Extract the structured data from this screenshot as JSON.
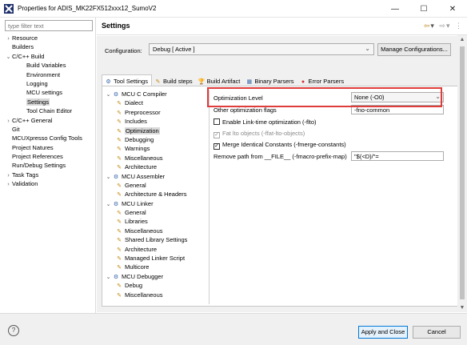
{
  "window": {
    "title": "Properties for ADIS_MK22FX512xxx12_SumoV2",
    "app_icon": "x-icon",
    "minimize_glyph": "—",
    "maximize_glyph": "☐",
    "close_glyph": "✕"
  },
  "sidebar": {
    "filter_placeholder": "type filter text",
    "items": [
      {
        "label": "Resource",
        "twisty": "›",
        "indent": 0
      },
      {
        "label": "Builders",
        "twisty": "",
        "indent": 0
      },
      {
        "label": "C/C++ Build",
        "twisty": "⌄",
        "indent": 0
      },
      {
        "label": "Build Variables",
        "twisty": "",
        "indent": 1
      },
      {
        "label": "Environment",
        "twisty": "",
        "indent": 1
      },
      {
        "label": "Logging",
        "twisty": "",
        "indent": 1
      },
      {
        "label": "MCU settings",
        "twisty": "",
        "indent": 1
      },
      {
        "label": "Settings",
        "twisty": "",
        "indent": 1,
        "selected": true
      },
      {
        "label": "Tool Chain Editor",
        "twisty": "",
        "indent": 1
      },
      {
        "label": "C/C++ General",
        "twisty": "›",
        "indent": 0
      },
      {
        "label": "Git",
        "twisty": "",
        "indent": 0
      },
      {
        "label": "MCUXpresso Config Tools",
        "twisty": "",
        "indent": 0
      },
      {
        "label": "Project Natures",
        "twisty": "",
        "indent": 0
      },
      {
        "label": "Project References",
        "twisty": "",
        "indent": 0
      },
      {
        "label": "Run/Debug Settings",
        "twisty": "",
        "indent": 0
      },
      {
        "label": "Task Tags",
        "twisty": "›",
        "indent": 0
      },
      {
        "label": "Validation",
        "twisty": "›",
        "indent": 0
      }
    ]
  },
  "header": {
    "title": "Settings",
    "back_glyph": "⇦",
    "dropdown_glyph": "▾",
    "forward_glyph": "⇨",
    "menu_glyph": "⋮"
  },
  "config": {
    "label": "Configuration:",
    "value": "Debug  [ Active ]",
    "manage_label": "Manage Configurations..."
  },
  "tabs": [
    {
      "label": "Tool Settings",
      "icon": "⚙",
      "active": true
    },
    {
      "label": "Build steps",
      "icon": "✎",
      "active": false
    },
    {
      "label": "Build Artifact",
      "icon": "🏆",
      "active": false
    },
    {
      "label": "Binary Parsers",
      "icon": "▦",
      "active": false
    },
    {
      "label": "Error Parsers",
      "icon": "●",
      "active": false
    }
  ],
  "tool_tree": [
    {
      "label": "MCU C Compiler",
      "type": "tool",
      "twisty": "⌄",
      "indent": 0
    },
    {
      "label": "Dialect",
      "type": "option",
      "indent": 1
    },
    {
      "label": "Preprocessor",
      "type": "option",
      "indent": 1
    },
    {
      "label": "Includes",
      "type": "option",
      "indent": 1
    },
    {
      "label": "Optimization",
      "type": "option",
      "indent": 1,
      "selected": true
    },
    {
      "label": "Debugging",
      "type": "option",
      "indent": 1
    },
    {
      "label": "Warnings",
      "type": "option",
      "indent": 1
    },
    {
      "label": "Miscellaneous",
      "type": "option",
      "indent": 1
    },
    {
      "label": "Architecture",
      "type": "option",
      "indent": 1
    },
    {
      "label": "MCU Assembler",
      "type": "tool",
      "twisty": "⌄",
      "indent": 0
    },
    {
      "label": "General",
      "type": "option",
      "indent": 1
    },
    {
      "label": "Architecture & Headers",
      "type": "option",
      "indent": 1
    },
    {
      "label": "MCU Linker",
      "type": "tool",
      "twisty": "⌄",
      "indent": 0
    },
    {
      "label": "General",
      "type": "option",
      "indent": 1
    },
    {
      "label": "Libraries",
      "type": "option",
      "indent": 1
    },
    {
      "label": "Miscellaneous",
      "type": "option",
      "indent": 1
    },
    {
      "label": "Shared Library Settings",
      "type": "option",
      "indent": 1
    },
    {
      "label": "Architecture",
      "type": "option",
      "indent": 1
    },
    {
      "label": "Managed Linker Script",
      "type": "option",
      "indent": 1
    },
    {
      "label": "Multicore",
      "type": "option",
      "indent": 1
    },
    {
      "label": "MCU Debugger",
      "type": "tool",
      "twisty": "⌄",
      "indent": 0
    },
    {
      "label": "Debug",
      "type": "option",
      "indent": 1
    },
    {
      "label": "Miscellaneous",
      "type": "option",
      "indent": 1
    }
  ],
  "options": {
    "optimization_level_label": "Optimization Level",
    "optimization_level_value": "None (-O0)",
    "other_flags_label": "Other optimization flags",
    "other_flags_value": "-fno-common",
    "lto_label": "Enable Link-time optimization (-flto)",
    "lto_checked": false,
    "fat_lto_label": "Fat lto objects (-ffat-lto-objects)",
    "fat_lto_checked": true,
    "merge_constants_label": "Merge Identical Constants (-fmerge-constants)",
    "merge_constants_checked": true,
    "prefix_map_label": "Remove path from __FILE__ (-fmacro-prefix-map)",
    "prefix_map_value": "\"$(<D)/\"="
  },
  "footer": {
    "help_glyph": "?",
    "apply_label": "Apply and Close",
    "cancel_label": "Cancel"
  },
  "colors": {
    "highlight_box": "#e03c3c",
    "primary_button_border": "#0078d7",
    "selection_bg": "#d9d9d9"
  }
}
